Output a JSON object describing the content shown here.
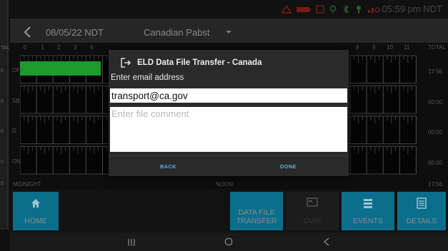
{
  "status_bar": {
    "time": "05:59 pm NDT",
    "icons": [
      "alert-icon",
      "battery-icon",
      "tablet-icon",
      "location-icon",
      "bluetooth-icon",
      "truck-connection-icon",
      "signal-icon"
    ],
    "icon_color": "#cc2222"
  },
  "header": {
    "date": "08/05/22 NDT",
    "carrier": "Canadian Pabst"
  },
  "graph": {
    "hours": [
      "0",
      "1",
      "2",
      "3",
      "4",
      "8",
      "9",
      "10",
      "11"
    ],
    "total_header": "TOTAL",
    "rows": [
      {
        "label": "OFF",
        "total": "17:56"
      },
      {
        "label": "SB",
        "total": "00:00"
      },
      {
        "label": "D",
        "total": "00:00"
      },
      {
        "label": "ON",
        "total": "00:00"
      }
    ],
    "footer_left": "MIDNIGHT",
    "footer_mid": "NOON",
    "footer_right": "17:56",
    "off_duty_fill_hours": 4.9,
    "duty_color": "#1f9a2c"
  },
  "left_edge": {
    "labels": [
      "TAL",
      "6",
      "0",
      "0",
      "0",
      "6"
    ]
  },
  "dialog": {
    "title": "ELD Data File Transfer - Canada",
    "email_label": "Enter email address",
    "email_value": "transport@ca.gov",
    "comment_placeholder": "Enter file comment",
    "back_label": "BACK",
    "done_label": "DONE",
    "accent_color": "#4fb1e8"
  },
  "bottom_nav": {
    "home_label": "HOME",
    "data_transfer_label": "DATA FILE TRANSFER",
    "dvir_label": "DVIR",
    "events_label": "EVENTS",
    "details_label": "DETAILS",
    "button_color": "#0b6f8c"
  },
  "system_nav": {
    "recents_icon": "recents-icon",
    "home_icon": "circle-home-icon",
    "back_icon": "triangle-back-icon"
  }
}
